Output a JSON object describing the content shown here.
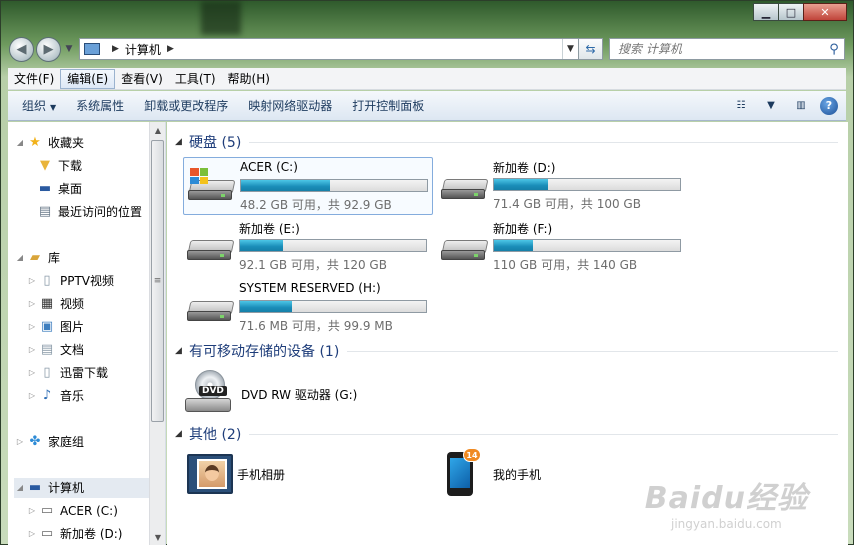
{
  "window": {
    "minimize_glyph": "▁",
    "maximize_glyph": "□",
    "close_glyph": "✕"
  },
  "address": {
    "crumb": "计算机",
    "search_placeholder": "搜索 计算机"
  },
  "menubar": [
    {
      "label": "文件(F)"
    },
    {
      "label": "编辑(E)"
    },
    {
      "label": "查看(V)"
    },
    {
      "label": "工具(T)"
    },
    {
      "label": "帮助(H)"
    }
  ],
  "commands": [
    {
      "label": "组织"
    },
    {
      "label": "系统属性"
    },
    {
      "label": "卸载或更改程序"
    },
    {
      "label": "映射网络驱动器"
    },
    {
      "label": "打开控制面板"
    }
  ],
  "sidebar": {
    "favorites": {
      "label": "收藏夹",
      "items": [
        {
          "label": "下载",
          "icon": "download-folder-icon"
        },
        {
          "label": "桌面",
          "icon": "desktop-icon"
        },
        {
          "label": "最近访问的位置",
          "icon": "recent-places-icon"
        }
      ]
    },
    "libraries": {
      "label": "库",
      "items": [
        {
          "label": "PPTV视频",
          "icon": "library-icon"
        },
        {
          "label": "视频",
          "icon": "video-icon"
        },
        {
          "label": "图片",
          "icon": "picture-icon"
        },
        {
          "label": "文档",
          "icon": "document-icon"
        },
        {
          "label": "迅雷下载",
          "icon": "library-icon"
        },
        {
          "label": "音乐",
          "icon": "music-icon"
        }
      ]
    },
    "homegroup": {
      "label": "家庭组"
    },
    "computer": {
      "label": "计算机",
      "items": [
        {
          "label": "ACER (C:)"
        },
        {
          "label": "新加卷 (D:)"
        }
      ]
    }
  },
  "groups": {
    "hard_disks": "硬盘 (5)",
    "removable": "有可移动存储的设备 (1)",
    "other": "其他 (2)"
  },
  "drives": [
    {
      "name": "ACER (C:)",
      "used_fraction": 0.48,
      "free_text": "48.2 GB 可用，共 92.9 GB"
    },
    {
      "name": "新加卷 (D:)",
      "used_fraction": 0.29,
      "free_text": "71.4 GB 可用，共 100 GB"
    },
    {
      "name": "新加卷 (E:)",
      "used_fraction": 0.23,
      "free_text": "92.1 GB 可用，共 120 GB"
    },
    {
      "name": "新加卷 (F:)",
      "used_fraction": 0.21,
      "free_text": "110 GB 可用，共 140 GB"
    },
    {
      "name": "SYSTEM RESERVED (H:)",
      "used_fraction": 0.28,
      "free_text": "71.6 MB 可用，共 99.9 MB"
    }
  ],
  "dvd": {
    "name": "DVD RW 驱动器 (G:)",
    "badge": "DVD"
  },
  "others": [
    {
      "name": "手机相册"
    },
    {
      "name": "我的手机",
      "badge": "14"
    }
  ],
  "watermark": {
    "line1": "Baidu经验",
    "line2": "jingyan.baidu.com"
  }
}
